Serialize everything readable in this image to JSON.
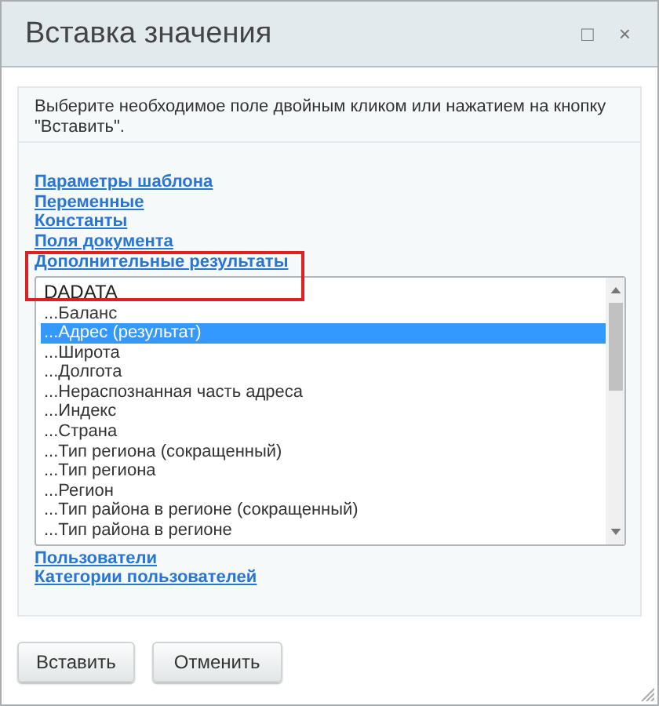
{
  "window": {
    "title": "Вставка значения",
    "controls": [
      "□",
      "×"
    ]
  },
  "instruction": "Выберите необходимое поле двойным кликом или нажатием на кнопку \"Вставить\".",
  "links_before": [
    "Параметры шаблона",
    "Переменные",
    "Константы",
    "Поля документа",
    "Дополнительные результаты"
  ],
  "list": {
    "group": "DADATA",
    "items": [
      {
        "label": "...Баланс",
        "selected": false
      },
      {
        "label": "...Адрес (результат)",
        "selected": true
      },
      {
        "label": "...Широта",
        "selected": false
      },
      {
        "label": "...Долгота",
        "selected": false
      },
      {
        "label": "...Нераспознанная часть адреса",
        "selected": false
      },
      {
        "label": "...Индекс",
        "selected": false
      },
      {
        "label": "...Страна",
        "selected": false
      },
      {
        "label": "...Тип региона (сокращенный)",
        "selected": false
      },
      {
        "label": "...Тип региона",
        "selected": false
      },
      {
        "label": "...Регион",
        "selected": false
      },
      {
        "label": "...Тип района в регионе (сокращенный)",
        "selected": false
      },
      {
        "label": "...Тип района в регионе",
        "selected": false
      }
    ]
  },
  "links_after": [
    "Пользователи",
    "Категории пользователей"
  ],
  "buttons": [
    "Вставить",
    "Отменить"
  ]
}
